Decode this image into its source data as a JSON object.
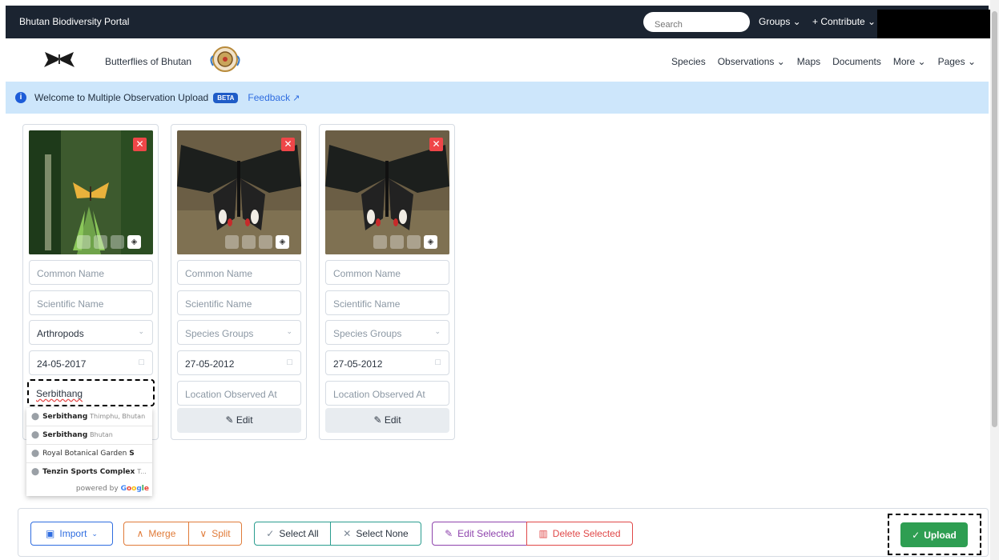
{
  "topbar": {
    "title": "Bhutan Biodiversity Portal",
    "search_placeholder": "Search",
    "groups": "Groups ⌄",
    "contribute": "+ Contribute ⌄"
  },
  "nav": {
    "brand": "Butterflies of Bhutan",
    "links": [
      "Species",
      "Observations ⌄",
      "Maps",
      "Documents",
      "More ⌄",
      "Pages ⌄"
    ]
  },
  "info": {
    "message": "Welcome to Multiple Observation Upload",
    "badge": "BETA",
    "feedback": "Feedback"
  },
  "cards": [
    {
      "common_name": "Common Name",
      "scientific_name": "Scientific Name",
      "species_group": "Arthropods",
      "date": "24-05-2017",
      "location": "Serbithang"
    },
    {
      "common_name": "Common Name",
      "scientific_name": "Scientific Name",
      "species_group": "Species Groups",
      "date": "27-05-2012",
      "location": "Location Observed At",
      "edit": "Edit"
    },
    {
      "common_name": "Common Name",
      "scientific_name": "Scientific Name",
      "species_group": "Species Groups",
      "date": "27-05-2012",
      "location": "Location Observed At",
      "edit": "Edit"
    }
  ],
  "autocomplete": {
    "items": [
      {
        "main": "Serbithang",
        "secondary": "Thimphu, Bhutan"
      },
      {
        "main": "Serbithang",
        "secondary": "Bhutan"
      },
      {
        "main": "Royal Botanical Garden",
        "bold_tail": "S"
      },
      {
        "main": "Tenzin Sports Complex",
        "secondary": "T..."
      }
    ],
    "powered_by": "powered by"
  },
  "toolbar": {
    "import": "Import",
    "merge": "Merge",
    "split": "Split",
    "select_all": "Select All",
    "select_none": "Select None",
    "edit_selected": "Edit Selected",
    "delete_selected": "Delete Selected",
    "upload": "Upload"
  },
  "colors": {
    "topbar": "#1b2431",
    "infobar": "#cde6fb",
    "upload": "#2e9e52",
    "remove": "#ef4648"
  }
}
